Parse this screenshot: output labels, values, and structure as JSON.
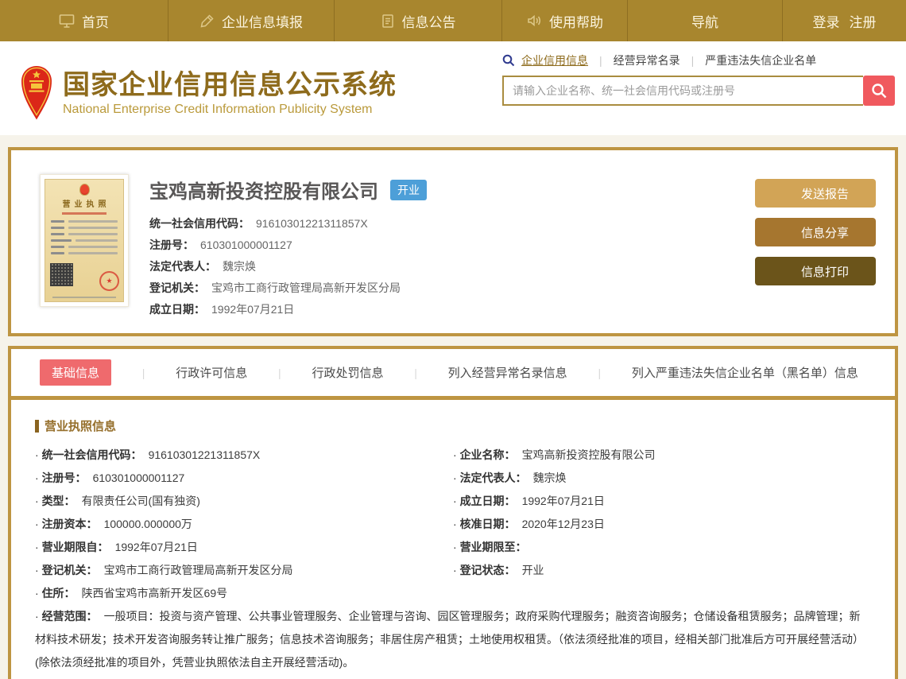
{
  "nav": {
    "items": [
      {
        "label": "首页"
      },
      {
        "label": "企业信息填报"
      },
      {
        "label": "信息公告"
      },
      {
        "label": "使用帮助"
      },
      {
        "label": "导航"
      }
    ],
    "login": "登录",
    "register": "注册"
  },
  "header": {
    "title_cn": "国家企业信用信息公示系统",
    "title_en": "National Enterprise Credit Information Publicity System",
    "search_tabs": [
      "企业信用信息",
      "经营异常名录",
      "严重违法失信企业名单"
    ],
    "active_search_tab": "企业信用信息",
    "search_placeholder": "请输入企业名称、统一社会信用代码或注册号"
  },
  "summary": {
    "company_name": "宝鸡高新投资控股有限公司",
    "status_badge": "开业",
    "license_title": "营业执照",
    "fields": [
      {
        "label": "统一社会信用代码：",
        "value": "91610301221311857X"
      },
      {
        "label": "注册号：",
        "value": "610301000001127"
      },
      {
        "label": "法定代表人：",
        "value": "魏宗焕"
      },
      {
        "label": "登记机关：",
        "value": "宝鸡市工商行政管理局高新开发区分局"
      },
      {
        "label": "成立日期：",
        "value": "1992年07月21日"
      }
    ],
    "buttons": [
      "发送报告",
      "信息分享",
      "信息打印"
    ]
  },
  "tabs": {
    "active": "基础信息",
    "items": [
      "基础信息",
      "行政许可信息",
      "行政处罚信息",
      "列入经营异常名录信息",
      "列入严重违法失信企业名单（黑名单）信息"
    ]
  },
  "detail": {
    "section_title": "营业执照信息",
    "left": [
      {
        "label": "统一社会信用代码：",
        "value": "91610301221311857X"
      },
      {
        "label": "注册号：",
        "value": "610301000001127"
      },
      {
        "label": "类型：",
        "value": "有限责任公司(国有独资)"
      },
      {
        "label": "注册资本：",
        "value": "100000.000000万"
      },
      {
        "label": "营业期限自：",
        "value": "1992年07月21日"
      },
      {
        "label": "登记机关：",
        "value": "宝鸡市工商行政管理局高新开发区分局"
      },
      {
        "label": "住所：",
        "value": "陕西省宝鸡市高新开发区69号"
      }
    ],
    "right": [
      {
        "label": "企业名称：",
        "value": "宝鸡高新投资控股有限公司"
      },
      {
        "label": "法定代表人：",
        "value": "魏宗焕"
      },
      {
        "label": "成立日期：",
        "value": "1992年07月21日"
      },
      {
        "label": "核准日期：",
        "value": "2020年12月23日"
      },
      {
        "label": "营业期限至：",
        "value": ""
      },
      {
        "label": "登记状态：",
        "value": "开业"
      }
    ],
    "scope_label": "经营范围：",
    "scope_value": "一般项目：投资与资产管理、公共事业管理服务、企业管理与咨询、园区管理服务；政府采购代理服务；融资咨询服务；仓储设备租赁服务；品牌管理；新材料技术研发；技术开发咨询服务转让推广服务；信息技术咨询服务；非居住房产租赁；土地使用权租赁。（依法须经批准的项目，经相关部门批准后方可开展经营活动）(除依法须经批准的项目外，凭营业执照依法自主开展经营活动)。"
  },
  "colors": {
    "nav_gold": "#A8862E",
    "card_border_gold": "#BE9542",
    "search_button_red": "#F0595E",
    "tab_active_red": "#EF6A6D",
    "status_badge_blue": "#4D9FD8",
    "title_brown": "#8E6B1C",
    "magnifier_blue": "#2F3A8F"
  }
}
